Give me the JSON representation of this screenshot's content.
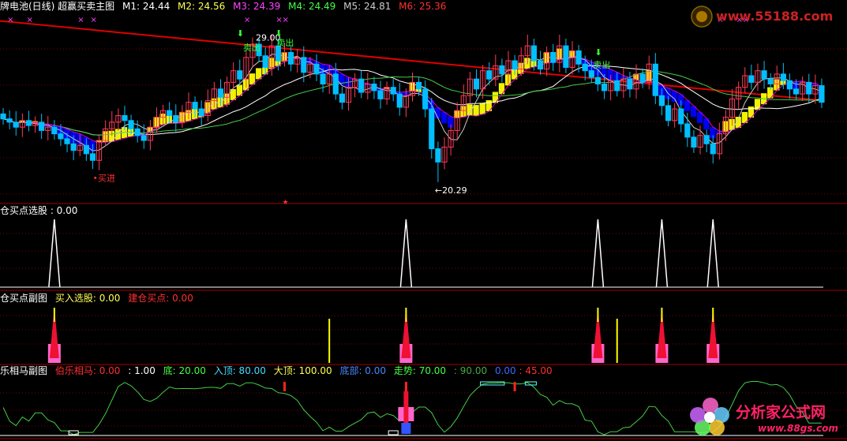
{
  "colors": {
    "up": "#ff3a5a",
    "down": "#00bfff",
    "ma_long": "#e00000",
    "yellow": "#ffff00",
    "blue_band": "#0000ff",
    "purple": "#d000d0",
    "green_line": "#44cc44",
    "white": "#ffffff",
    "grid": "#7a0000",
    "sep": "#a00000"
  },
  "main": {
    "title": "牌电池(日线) 超赢买卖主图",
    "m1": "M1: 24.44",
    "m2": "M2: 24.56",
    "m3": "M3: 24.39",
    "m4": "M4: 24.49",
    "m5": "M5: 24.81",
    "m6": "M6: 25.36",
    "high_label": "29.00",
    "low_label": "←20.29",
    "buy_label": "•买进",
    "sell_label": "卖出",
    "sell_label2": "卖出",
    "sell_label3": "卖出",
    "marker_x": "×"
  },
  "panel2": {
    "title": "仓买点选股 : 0.00"
  },
  "panel3": {
    "title": "仓买点副图",
    "t1": "买入选股: 0.00",
    "t2": "建仓买点: 0.00"
  },
  "panel4": {
    "title": "乐相马副图",
    "t1": "伯乐相马: 0.00",
    "t2": ": 1.00",
    "t3": "底: 20.00",
    "t4": "入顶: 80.00",
    "t5": "大顶: 100.00",
    "t6": "底部: 0.00",
    "t7": "走势: 70.00",
    "t8": ": 90.00",
    "t9": "0.00",
    "t10": ": 45.00"
  },
  "watermark": {
    "top": "www.55188.com",
    "bottom": "分析家公式网",
    "bottom_url": "www.88gs.com"
  },
  "chart_data": [
    {
      "type": "candlestick",
      "title": "牌电池(日线) 超赢买卖主图",
      "annotations": [
        "29.00",
        "←20.29",
        "买进",
        "卖出"
      ],
      "high": 29.0,
      "low": 20.29,
      "ylim": [
        19.0,
        30.5
      ],
      "close": [
        24.1,
        23.9,
        23.6,
        24.0,
        23.7,
        23.9,
        23.4,
        23.6,
        23.2,
        22.9,
        22.6,
        22.2,
        22.5,
        22.0,
        21.6,
        22.8,
        23.5,
        23.9,
        24.3,
        24.0,
        23.5,
        23.1,
        22.8,
        23.6,
        24.2,
        24.6,
        24.3,
        23.9,
        24.5,
        25.1,
        24.7,
        24.3,
        25.2,
        25.9,
        25.4,
        26.3,
        27.0,
        26.5,
        27.8,
        28.6,
        27.9,
        27.2,
        28.5,
        27.6,
        28.1,
        27.4,
        27.8,
        26.9,
        27.4,
        26.8,
        26.2,
        26.8,
        25.6,
        25.1,
        26.0,
        26.5,
        25.7,
        26.2,
        25.8,
        25.3,
        26.0,
        25.6,
        24.8,
        25.5,
        26.3,
        25.9,
        24.7,
        22.3,
        21.5,
        22.4,
        23.4,
        24.6,
        25.5,
        26.5,
        25.9,
        27.0,
        26.5,
        27.3,
        26.8,
        27.6,
        27.1,
        27.9,
        28.5,
        27.6,
        27.1,
        28.1,
        27.5,
        28.5,
        27.2,
        28.2,
        27.4,
        27.0,
        26.6,
        26.2,
        25.8,
        26.4,
        25.8,
        26.5,
        25.9,
        26.8,
        26.3,
        27.4,
        25.5,
        24.9,
        24.0,
        24.7,
        23.8,
        23.0,
        22.4,
        23.1,
        22.6,
        22.0,
        23.2,
        24.2,
        25.3,
        26.0,
        26.7,
        26.3,
        27.0,
        26.5,
        26.2,
        26.8,
        26.4,
        25.9,
        25.6,
        26.3,
        25.6,
        26.1,
        25.1
      ]
    },
    {
      "type": "line",
      "title": "仓买点选股",
      "spike_index": [
        8,
        63,
        93,
        103,
        111
      ]
    },
    {
      "type": "bar",
      "title": "仓买点副图",
      "spike_index": [
        8,
        63,
        93,
        103,
        111
      ],
      "yellow_index": [
        51,
        96
      ]
    },
    {
      "type": "line",
      "title": "乐相马副图",
      "levels": [
        20,
        45,
        70,
        80,
        90,
        100
      ]
    }
  ]
}
